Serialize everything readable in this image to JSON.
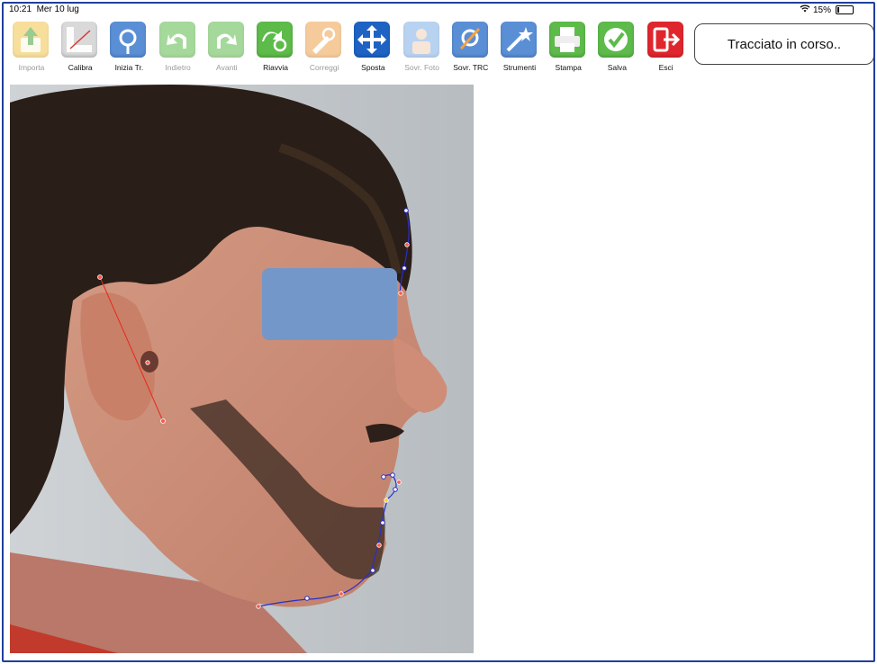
{
  "status_bar": {
    "time": "10:21",
    "date": "Mer 10 lug",
    "battery": "15%",
    "battery_level": 0.15
  },
  "toolbar": {
    "items": [
      {
        "id": "importa",
        "label": "Importa",
        "enabled": false,
        "color": "#f2c64a",
        "icon": "import-icon"
      },
      {
        "id": "calibra",
        "label": "Calibra",
        "enabled": true,
        "color": "#d9d9d9",
        "icon": "ruler-icon"
      },
      {
        "id": "inizia",
        "label": "Inizia Tr.",
        "enabled": true,
        "color": "#5a8fd6",
        "icon": "start-trace-icon"
      },
      {
        "id": "indietro",
        "label": "Indietro",
        "enabled": false,
        "color": "#5dbb4a",
        "icon": "undo-icon"
      },
      {
        "id": "avanti",
        "label": "Avanti",
        "enabled": false,
        "color": "#5dbb4a",
        "icon": "redo-icon"
      },
      {
        "id": "riavvia",
        "label": "Riavvia",
        "enabled": true,
        "color": "#5dbb4a",
        "icon": "restart-icon"
      },
      {
        "id": "correggi",
        "label": "Correggi",
        "enabled": false,
        "color": "#f0a24a",
        "icon": "correct-icon"
      },
      {
        "id": "sposta",
        "label": "Sposta",
        "enabled": true,
        "color": "#1e63c4",
        "icon": "move-icon"
      },
      {
        "id": "sovrfoto",
        "label": "Sovr. Foto",
        "enabled": false,
        "color": "#7fb0e6",
        "icon": "overlay-photo-icon"
      },
      {
        "id": "sovrtrc",
        "label": "Sovr. TRC",
        "enabled": true,
        "color": "#5a8fd6",
        "icon": "overlay-trc-icon"
      },
      {
        "id": "strumenti",
        "label": "Strumenti",
        "enabled": true,
        "color": "#5a8fd6",
        "icon": "tools-icon"
      },
      {
        "id": "stampa",
        "label": "Stampa",
        "enabled": true,
        "color": "#5dbb4a",
        "icon": "print-icon"
      },
      {
        "id": "salva",
        "label": "Salva",
        "enabled": true,
        "color": "#5dbb4a",
        "icon": "save-check-icon"
      },
      {
        "id": "esci",
        "label": "Esci",
        "enabled": true,
        "color": "#e0262d",
        "icon": "exit-icon"
      }
    ]
  },
  "status_message": "Tracciato in corso.."
}
